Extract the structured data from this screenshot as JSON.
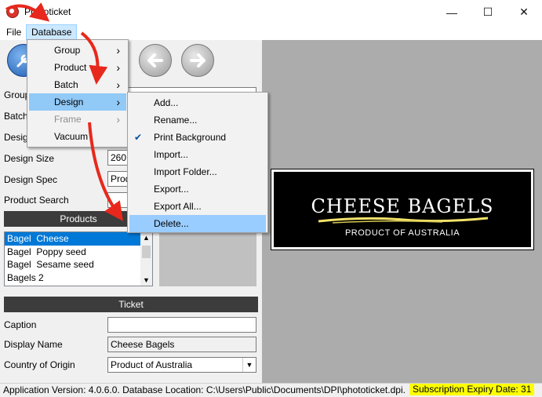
{
  "window": {
    "title": "Phototicket",
    "minimize_icon": "minimize-icon",
    "maximize_icon": "maximize-icon",
    "close_icon": "close-icon"
  },
  "menubar": {
    "file": "File",
    "database": "Database"
  },
  "database_menu": {
    "items": [
      {
        "label": "Group",
        "has_submenu": true,
        "enabled": true
      },
      {
        "label": "Product",
        "has_submenu": true,
        "enabled": true
      },
      {
        "label": "Batch",
        "has_submenu": true,
        "enabled": true
      },
      {
        "label": "Design",
        "has_submenu": true,
        "enabled": true,
        "highlighted": true
      },
      {
        "label": "Frame",
        "has_submenu": true,
        "enabled": false
      },
      {
        "label": "Vacuum",
        "has_submenu": false,
        "enabled": true
      }
    ]
  },
  "design_submenu": {
    "items": [
      {
        "label": "Add..."
      },
      {
        "label": "Rename..."
      },
      {
        "label": "Print Background",
        "checked": true
      },
      {
        "label": "Import..."
      },
      {
        "label": "Import Folder..."
      },
      {
        "label": "Export..."
      },
      {
        "label": "Export All..."
      },
      {
        "label": "Delete...",
        "highlighted": true
      }
    ]
  },
  "form": {
    "group_label": "Group",
    "batch_label": "Batch",
    "design_label": "Design",
    "design_size_label": "Design Size",
    "design_size_value": "260",
    "design_spec_label": "Design Spec",
    "design_spec_value": "Prod",
    "product_search_label": "Product Search"
  },
  "products": {
    "header": "Products",
    "items": [
      "Bagel  Cheese",
      "Bagel  Poppy seed",
      "Bagel  Sesame seed",
      "Bagels 2"
    ],
    "selected_index": 0
  },
  "ticket": {
    "header": "Ticket",
    "caption_label": "Caption",
    "caption_value": "",
    "display_name_label": "Display Name",
    "display_name_value": "Cheese Bagels",
    "country_label": "Country of Origin",
    "country_value": "Product of Australia"
  },
  "preview": {
    "title": "CHEESE BAGELS",
    "subtitle": "PRODUCT OF AUSTRALIA"
  },
  "status": {
    "text": "Application Version: 4.0.6.0.  Database Location: C:\\Users\\Public\\Documents\\DPI\\phototicket.dpi.",
    "expiry": "Subscription Expiry Date: 31"
  },
  "colors": {
    "accent": "#0078d7",
    "menu_highlight": "#91c9f7",
    "status_highlight": "#ffff00",
    "annotation_arrow": "#e8281c"
  }
}
